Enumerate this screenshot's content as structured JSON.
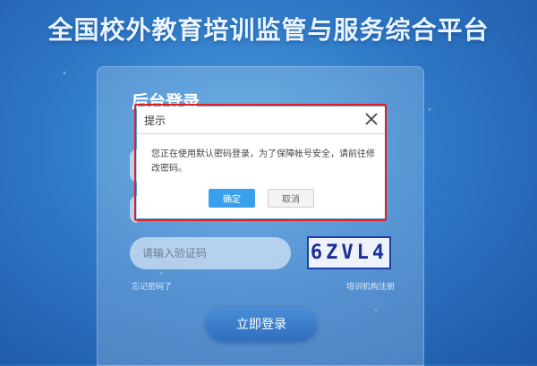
{
  "page": {
    "title": "全国校外教育培训监管与服务综合平台"
  },
  "login_panel": {
    "title": "后台登录",
    "captcha_placeholder": "请输入验证码",
    "captcha_text": "6ZVL4",
    "forgot_password": "忘记密码了",
    "institution_register": "培训机构注册",
    "login_button": "立即登录"
  },
  "dialog": {
    "title": "提示",
    "message": "您正在使用默认密码登录，为了保障帐号安全，请前往修改密码。",
    "confirm_label": "确定",
    "cancel_label": "取消",
    "close_icon": "close-icon"
  },
  "colors": {
    "background": "#2f79c7",
    "confirm": "#3aa0ee",
    "highlight": "#e02020",
    "captcha": "#1c2f99"
  }
}
